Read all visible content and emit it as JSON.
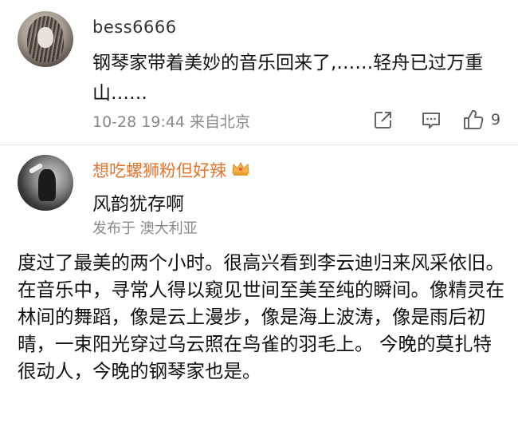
{
  "comment1": {
    "username": "bess6666",
    "text": "钢琴家带着美妙的音乐回来了,……轻舟已过万重山……",
    "meta": "10-28 19:44 来自北京",
    "likes": "9",
    "icons": [
      "share-icon",
      "comment-icon",
      "like-icon"
    ]
  },
  "comment2": {
    "username": "想吃螺狮粉但好辣",
    "text": "风韵犹存啊",
    "meta": "发布于 澳大利亚",
    "badge_icon": "crown-icon"
  },
  "article": {
    "text": "度过了最美的两个小时。很高兴看到李云迪归来风采依旧。 在音乐中，寻常人得以窥见世间至美至纯的瞬间。像精灵在林间的舞蹈，像是云上漫步，像是海上波涛，像是雨后初晴，一束阳光穿过乌云照在鸟雀的羽毛上。 今晚的莫扎特很动人，今晚的钢琴家也是。"
  },
  "colors": {
    "username_highlight": "#e5752d",
    "meta": "#888888"
  }
}
